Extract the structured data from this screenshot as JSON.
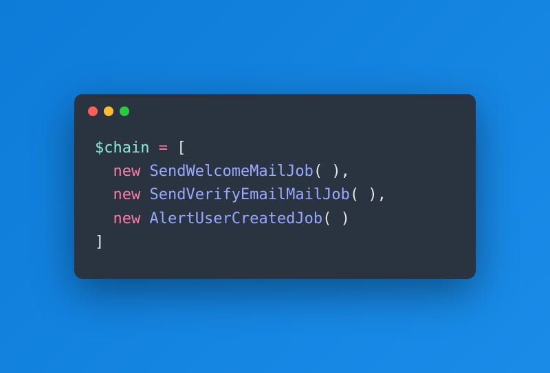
{
  "code": {
    "variable": "$chain",
    "operator": "=",
    "open_bracket": "[",
    "close_bracket": "]",
    "keyword": "new",
    "lines": [
      {
        "class": "SendWelcomeMailJob",
        "parens": "( )",
        "comma": ","
      },
      {
        "class": "SendVerifyEmailMailJob",
        "parens": "( )",
        "comma": ","
      },
      {
        "class": "AlertUserCreatedJob",
        "parens": "( )",
        "comma": ""
      }
    ]
  },
  "colors": {
    "background": "#0d7bd8",
    "window": "#2a3441",
    "red": "#ff5f56",
    "yellow": "#ffbd2e",
    "green": "#27c93f",
    "variable": "#8be9d8",
    "keyword": "#ff79a8",
    "classname": "#9aa8ff",
    "punctuation": "#e6e6e6"
  }
}
